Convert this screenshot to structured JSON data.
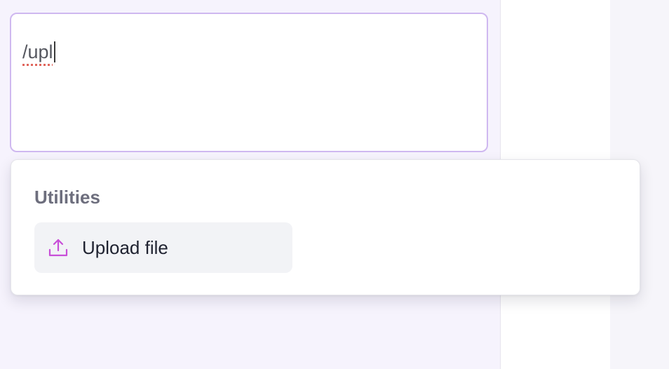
{
  "editor": {
    "value": "/upl"
  },
  "command_menu": {
    "section_label": "Utilities",
    "items": [
      {
        "label": "Upload file",
        "icon": "upload-icon"
      }
    ]
  },
  "colors": {
    "accent": "#c84fd8",
    "editor_border": "#cfb8f0",
    "page_bg": "#f6f3fd"
  }
}
